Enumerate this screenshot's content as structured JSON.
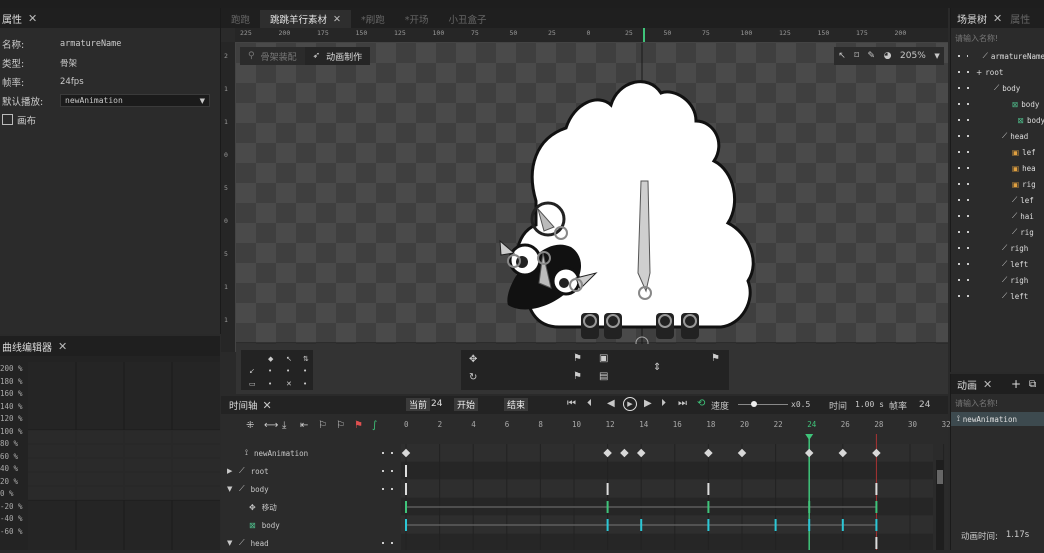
{
  "left_panel": {
    "tab_label": "属性",
    "rows": [
      {
        "key": "名称:",
        "value": "armatureName"
      },
      {
        "key": "类型:",
        "value": "骨架"
      },
      {
        "key": "帧率:",
        "value": "24fps"
      }
    ],
    "default_play_label": "默认播放:",
    "default_play_value": "newAnimation",
    "canvas_label": "画布"
  },
  "curve_editor": {
    "tab_label": "曲线编辑器",
    "y_labels": [
      "200 %",
      "180 %",
      "160 %",
      "140 %",
      "120 %",
      "100 %",
      "80 %",
      "60 %",
      "40 %",
      "20 %",
      "0 %",
      "-20 %",
      "-40 %",
      "-60 %"
    ]
  },
  "center": {
    "tabs": [
      {
        "label": "跑跑",
        "active": false
      },
      {
        "label": "跳跳羊行素材",
        "active": true
      },
      {
        "label": "*刷跑",
        "active": false
      },
      {
        "label": "*开场",
        "active": false
      },
      {
        "label": "小丑盒子",
        "active": false
      }
    ],
    "ruler_top_labels": [
      "225",
      "200",
      "175",
      "150",
      "125",
      "100",
      "75",
      "50",
      "25",
      "0",
      "25",
      "50",
      "75",
      "100",
      "125",
      "150",
      "175",
      "200"
    ],
    "ruler_left_labels": [
      "2",
      "1",
      "1",
      "0",
      "5",
      "0",
      "5",
      "1",
      "1"
    ],
    "mode_tabs": {
      "skeleton": "骨架装配",
      "animate": "动画制作"
    },
    "zoom": "205%"
  },
  "scene_panel": {
    "tabs": [
      "场景树",
      "属性"
    ],
    "search_placeholder": "请输入名称!",
    "items": [
      {
        "label": "armatureName",
        "indent": 34
      },
      {
        "label": "root",
        "indent": 22
      },
      {
        "label": "body",
        "indent": 42
      },
      {
        "label": "body",
        "indent": 60
      },
      {
        "label": "body",
        "indent": 68
      },
      {
        "label": "head",
        "indent": 50
      },
      {
        "label": "lef",
        "indent": 60
      },
      {
        "label": "hea",
        "indent": 60
      },
      {
        "label": "rig",
        "indent": 60
      },
      {
        "label": "lef",
        "indent": 60
      },
      {
        "label": "hai",
        "indent": 60
      },
      {
        "label": "rig",
        "indent": 60
      },
      {
        "label": "righ",
        "indent": 50
      },
      {
        "label": "left",
        "indent": 50
      },
      {
        "label": "righ",
        "indent": 50
      },
      {
        "label": "left",
        "indent": 50
      }
    ]
  },
  "anim_panel": {
    "tab_label": "动画",
    "search_placeholder": "请输入名称!",
    "item": "newAnimation",
    "duration_label": "动画时间:",
    "duration_value": "1.17s"
  },
  "timeline": {
    "tab_label": "时间轴",
    "current_label": "当前",
    "current_value": "24",
    "start_label": "开始",
    "end_label": "结束",
    "speed_label": "速度",
    "speed_value": "x0.5",
    "time_label": "时间",
    "time_value": "1.00 s",
    "frames_label": "帧率",
    "frames_value": "24",
    "frame_numbers": [
      "0",
      "2",
      "4",
      "6",
      "8",
      "10",
      "12",
      "14",
      "16",
      "18",
      "20",
      "22",
      "24",
      "26",
      "28",
      "30",
      "32"
    ],
    "rows": [
      {
        "label": "newAnimation"
      },
      {
        "label": "root"
      },
      {
        "label": "body"
      },
      {
        "label": "移动"
      },
      {
        "label": "body"
      },
      {
        "label": "head"
      }
    ]
  }
}
